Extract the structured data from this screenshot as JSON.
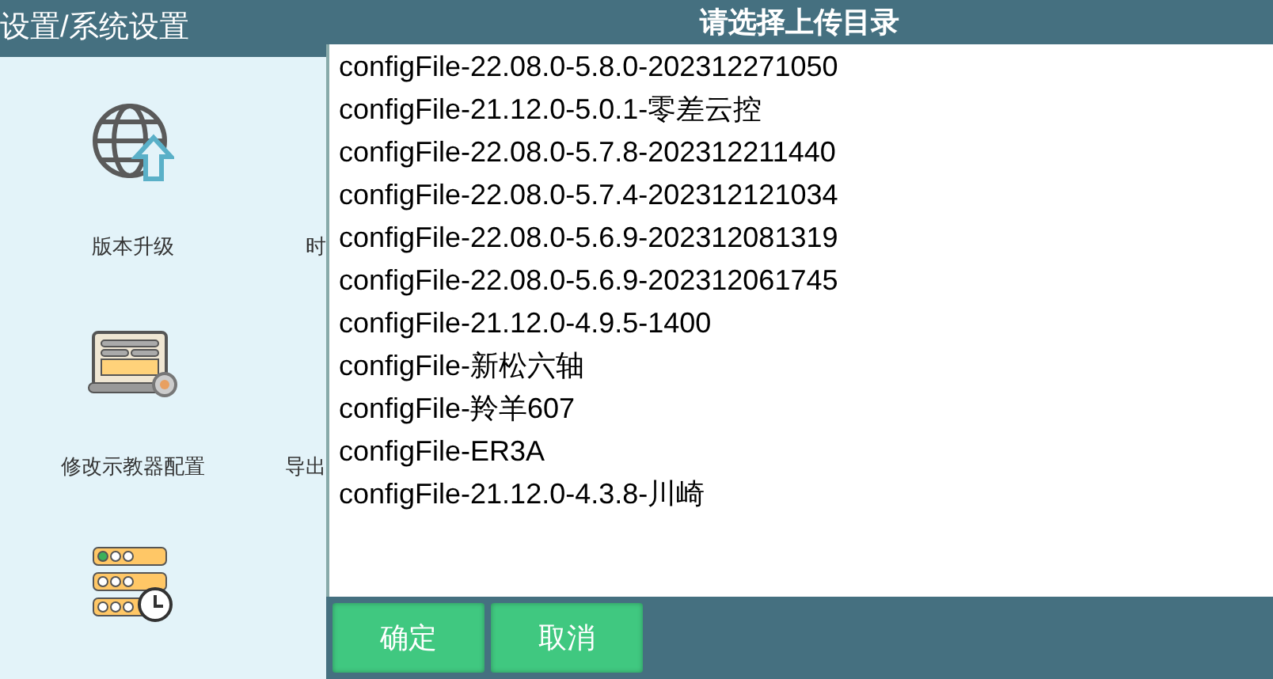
{
  "page": {
    "title": "设置/系统设置",
    "tiles": [
      {
        "kind": "globe",
        "label": "版本升级"
      },
      {
        "kind": "none",
        "label": "时"
      },
      {
        "kind": "laptop",
        "label": "修改示教器配置"
      },
      {
        "kind": "none",
        "label": "导出"
      },
      {
        "kind": "server"
      }
    ]
  },
  "dialog": {
    "title": "请选择上传目录",
    "items": [
      {
        "label": "configFile-22.08.0-5.8.0-202312271050",
        "selected": false
      },
      {
        "label": "configFile-21.12.0-5.0.1-零差云控",
        "selected": false
      },
      {
        "label": "configFile-22.08.0-5.7.8-202312211440",
        "selected": false
      },
      {
        "label": "configFile-22.08.0-5.7.4-202312121034",
        "selected": false
      },
      {
        "label": "configFile-22.08.0-5.6.9-202312081319",
        "selected": false
      },
      {
        "label": "configFile-22.08.0-5.6.9-202312061745",
        "selected": false
      },
      {
        "label": "configFile-21.12.0-4.9.5-1400",
        "selected": false
      },
      {
        "label": "configFile-新松六轴",
        "selected": false
      },
      {
        "label": "configFile-羚羊607",
        "selected": false
      },
      {
        "label": "configFile-ER3A",
        "selected": false
      },
      {
        "label": "configFile-21.12.0-4.3.8-川崎",
        "selected": false
      }
    ],
    "buttons": [
      "确定",
      "取消"
    ]
  }
}
